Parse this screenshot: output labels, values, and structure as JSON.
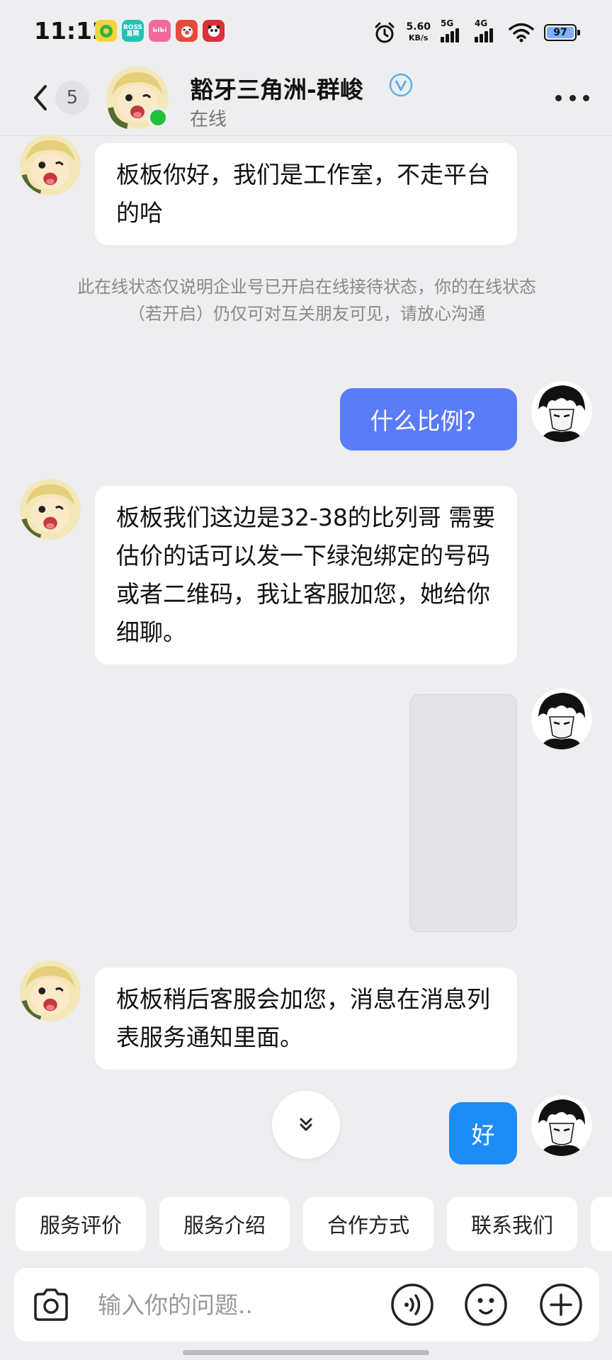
{
  "status_bar": {
    "time": "11:12",
    "apps": [
      {
        "name": "qq-music",
        "label": "",
        "color": "#f6d43a"
      },
      {
        "name": "boss-zhipin",
        "label": "BOSS直聘",
        "color": "#21c2b4"
      },
      {
        "name": "bilibili",
        "label": "ЬiЬi",
        "color": "#f06a9b"
      },
      {
        "name": "clown-app",
        "label": "",
        "color": "#e84a3a"
      },
      {
        "name": "panda-app",
        "label": "",
        "color": "#d9303a"
      }
    ],
    "net_speed_value": "5.60",
    "net_speed_unit": "KB/s",
    "signal_1_label": "5G",
    "signal_2_label": "4G",
    "battery_level": "97"
  },
  "header": {
    "unread_count": "5",
    "title": "豁牙三角洲-群峻",
    "status": "在线"
  },
  "messages": {
    "m1": "板板你好，我们是工作室，不走平台 的哈",
    "notice": "此在线状态仅说明企业号已开启在线接待状态，你的在线状态（若开启）仍仅可对互关朋友可见，请放心沟通",
    "m2": "什么比例？",
    "m3": "板板我们这边是32-38的比列哥 需要估价的话可以发一下绿泡绑定的号码或者二维码，我让客服加您，她给你细聊。",
    "m5": "板板稍后客服会加您，消息在消息列表服务通知里面。",
    "m6": "好"
  },
  "quick_replies": [
    "服务评价",
    "服务介绍",
    "合作方式",
    "联系我们",
    ""
  ],
  "input": {
    "placeholder": "输入你的问题.."
  },
  "colors": {
    "outgoing_bubble": "#5b7cf7",
    "outgoing_bubble_short": "#1e8cf5",
    "online_dot": "#22c03a",
    "verified": "#5aaff0"
  }
}
